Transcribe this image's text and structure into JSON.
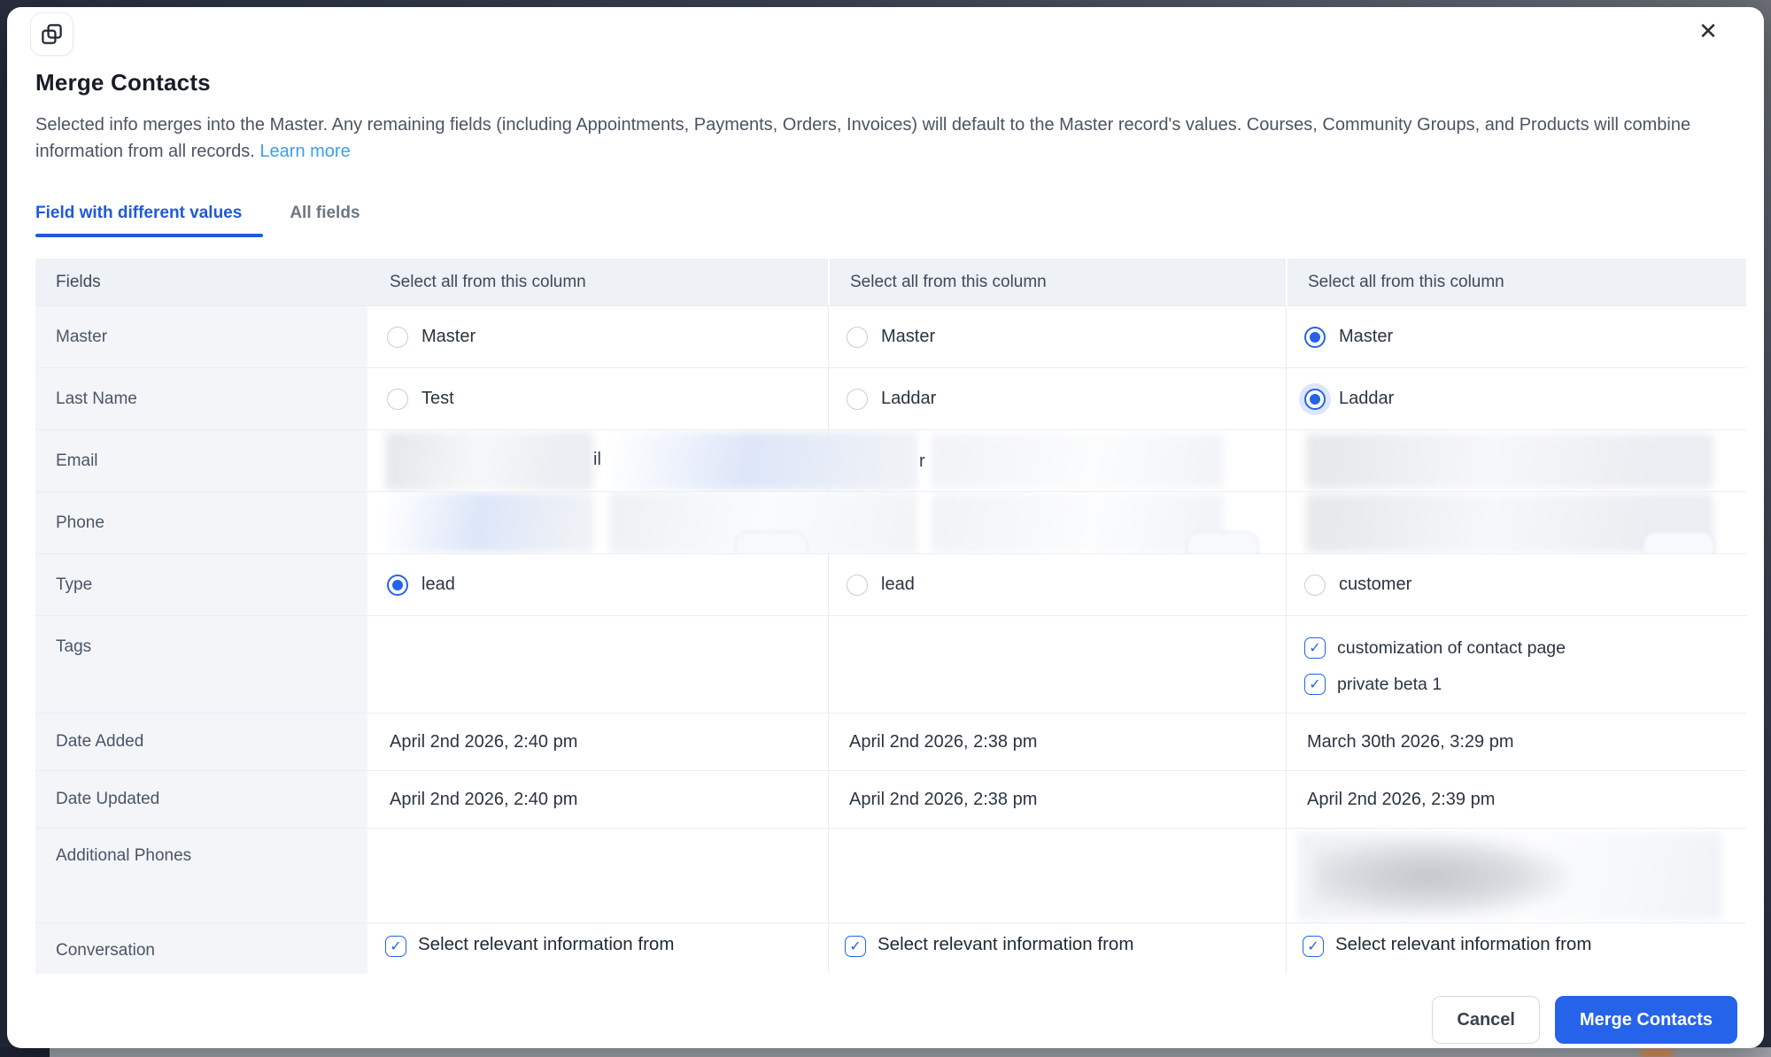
{
  "colors": {
    "accent_blue": "#2563eb",
    "link_blue": "#3d9fe8",
    "tab_active_blue": "#2158db"
  },
  "header": {
    "title": "Merge Contacts",
    "description": "Selected info merges into the Master. Any remaining fields (including Appointments, Payments, Orders, Invoices) will default to the Master record's values. Courses, Community Groups, and Products will combine information from all records.",
    "learn_more_label": "Learn more",
    "close_glyph": "✕",
    "check_glyph": "✓"
  },
  "tabs": {
    "active": "Field with different values",
    "inactive": "All fields"
  },
  "table": {
    "headers": [
      "Fields",
      "Select all from this column",
      "Select all from this column",
      "Select all from this column"
    ],
    "rows": {
      "master": {
        "field": "Master",
        "options": [
          {
            "label": "Master"
          },
          {
            "label": "Master"
          },
          {
            "label": "Master"
          }
        ]
      },
      "last_name": {
        "field": "Last Name",
        "options": [
          {
            "label": "Test"
          },
          {
            "label": "Laddar"
          },
          {
            "label": "Laddar"
          }
        ]
      },
      "email": {
        "field": "Email",
        "redaction_artifacts": [
          "il",
          "r"
        ]
      },
      "phone": {
        "field": "Phone"
      },
      "type": {
        "field": "Type",
        "options": [
          {
            "label": "lead"
          },
          {
            "label": "lead"
          },
          {
            "label": "customer"
          }
        ]
      },
      "tags": {
        "field": "Tags",
        "col3_tags": [
          "customization of contact page",
          "private beta 1"
        ]
      },
      "date_added": {
        "field": "Date Added",
        "values": [
          "April 2nd 2026, 2:40 pm",
          "April 2nd 2026, 2:38 pm",
          "March 30th 2026, 3:29 pm"
        ]
      },
      "date_updated": {
        "field": "Date Updated",
        "values": [
          "April 2nd 2026, 2:40 pm",
          "April 2nd 2026, 2:38 pm",
          "April 2nd 2026, 2:39 pm"
        ]
      },
      "additional_phones": {
        "field": "Additional Phones"
      },
      "conversation": {
        "field": "Conversation",
        "checkbox_label": "Select relevant information from"
      }
    },
    "selection_state": {
      "master_selected_column": 3,
      "last_name_selected_column": 3,
      "type_selected_column": 1,
      "tags_col3_checked": [
        true,
        true
      ],
      "conversation_checked_columns": [
        1,
        2,
        3
      ]
    }
  },
  "footer": {
    "cancel_label": "Cancel",
    "merge_label": "Merge Contacts"
  }
}
